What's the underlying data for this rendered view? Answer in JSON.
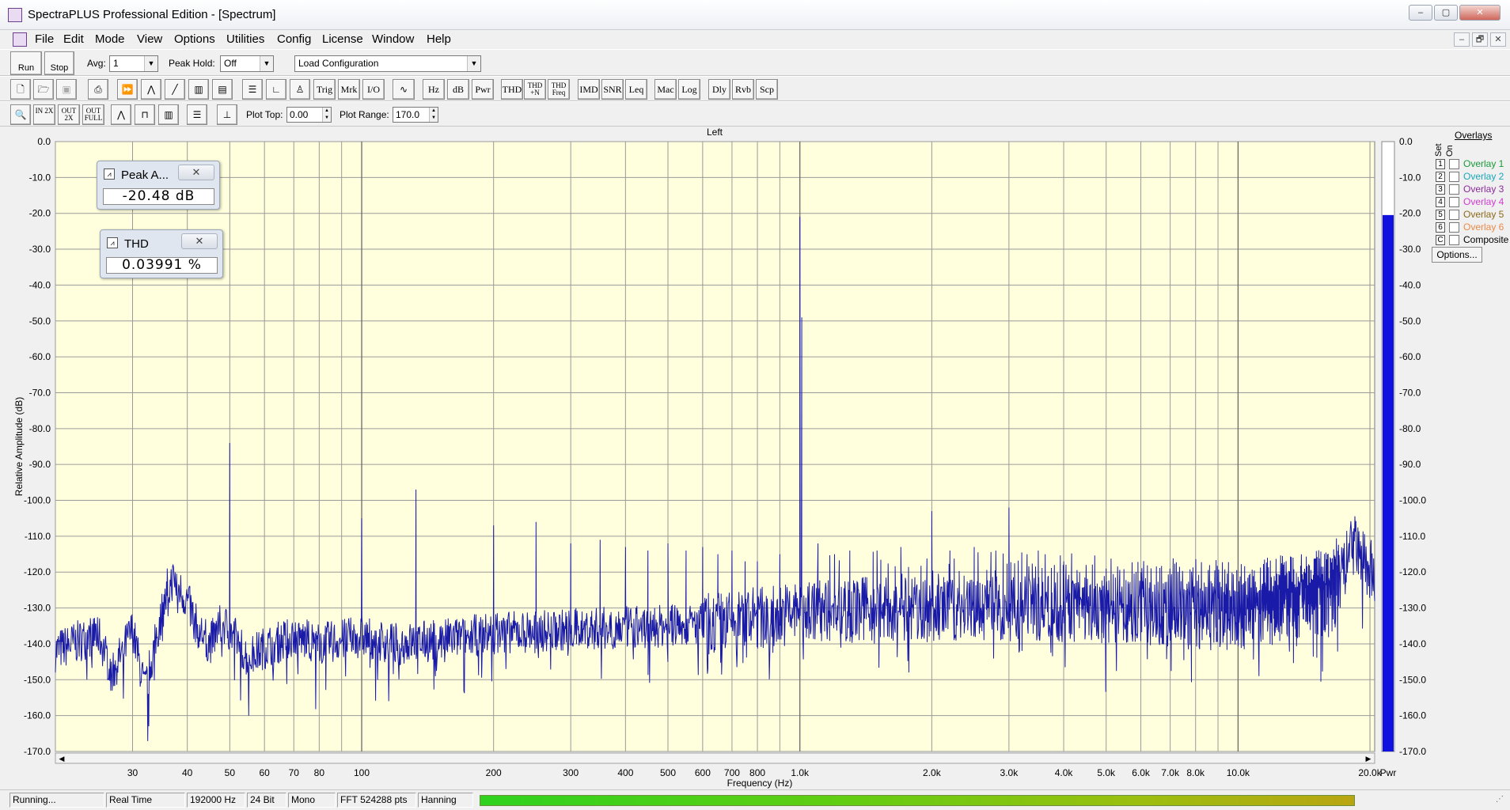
{
  "window": {
    "title": "SpectraPLUS Professional Edition - [Spectrum]",
    "controls": [
      "–",
      "▢",
      "✕"
    ],
    "mdi_controls": [
      "–",
      "🗗",
      "✕"
    ]
  },
  "menu": [
    "File",
    "Edit",
    "Mode",
    "View",
    "Options",
    "Utilities",
    "Config",
    "License",
    "Window",
    "Help"
  ],
  "toolbar1": {
    "run_label": "Run",
    "stop_label": "Stop",
    "avg_label": "Avg:",
    "avg_value": "1",
    "peakhold_label": "Peak Hold:",
    "peakhold_value": "Off",
    "config_value": "Load Configuration"
  },
  "toolbar2": {
    "buttons": [
      "Trig",
      "Mrk",
      "I/O",
      "Hz",
      "dB",
      "Pwr",
      "THD",
      "THD +N",
      "THD Freq",
      "IMD",
      "SNR",
      "Leq",
      "Mac",
      "Log",
      "Dly",
      "Rvb",
      "Scp"
    ]
  },
  "toolbar3": {
    "zoom_buttons": [
      "IN 2X",
      "OUT 2X",
      "OUT FULL"
    ],
    "plot_top_label": "Plot Top:",
    "plot_top_value": "0.00",
    "plot_range_label": "Plot Range:",
    "plot_range_value": "170.0"
  },
  "meters": [
    {
      "title": "Peak A...",
      "value": "-20.48 dB"
    },
    {
      "title": "THD",
      "value": "0.03991 %"
    }
  ],
  "overlays": {
    "title": "Overlays",
    "set_label": "Set",
    "on_label": "On",
    "rows": [
      {
        "num": "1",
        "label": "Overlay 1",
        "color": "#1a9a3a"
      },
      {
        "num": "2",
        "label": "Overlay 2",
        "color": "#1aa6b8"
      },
      {
        "num": "3",
        "label": "Overlay 3",
        "color": "#8a2a9a"
      },
      {
        "num": "4",
        "label": "Overlay 4",
        "color": "#d23ad2"
      },
      {
        "num": "5",
        "label": "Overlay 5",
        "color": "#8a6a1a"
      },
      {
        "num": "6",
        "label": "Overlay 6",
        "color": "#e88a4a"
      },
      {
        "num": "C",
        "label": "Composite",
        "color": "#000000"
      }
    ],
    "options_label": "Options..."
  },
  "status": {
    "cells": [
      "Running...",
      "Real Time",
      "192000 Hz",
      "24 Bit",
      "Mono",
      "FFT 524288 pts",
      "Hanning"
    ]
  },
  "chart_data": {
    "type": "line",
    "title": "Left",
    "xlabel": "Frequency (Hz)",
    "ylabel": "Relative Amplitude (dB)",
    "x_scale": "log",
    "xlim": [
      20,
      20500
    ],
    "ylim": [
      -170,
      0
    ],
    "grid": true,
    "x_ticks": [
      30,
      40,
      50,
      60,
      70,
      80,
      100,
      200,
      300,
      400,
      500,
      600,
      700,
      800,
      1000,
      2000,
      3000,
      4000,
      5000,
      6000,
      7000,
      8000,
      10000,
      20000
    ],
    "x_tick_labels": [
      "30",
      "40",
      "50",
      "60",
      "70",
      "80",
      "100",
      "200",
      "300",
      "400",
      "500",
      "600",
      "700",
      "800",
      "1.0k",
      "2.0k",
      "3.0k",
      "4.0k",
      "5.0k",
      "6.0k",
      "7.0k",
      "8.0k",
      "10.0k",
      "20.0k"
    ],
    "y_ticks": [
      0,
      -10,
      -20,
      -30,
      -40,
      -50,
      -60,
      -70,
      -80,
      -90,
      -100,
      -110,
      -120,
      -130,
      -140,
      -150,
      -160,
      -170
    ],
    "y_tick_labels": [
      "0.0",
      "-10.0",
      "-20.0",
      "-30.0",
      "-40.0",
      "-50.0",
      "-60.0",
      "-70.0",
      "-80.0",
      "-90.0",
      "-100.0",
      "-110.0",
      "-120.0",
      "-130.0",
      "-140.0",
      "-150.0",
      "-160.0",
      "-170.0"
    ],
    "series_color": "#1a1aa8",
    "plot_bg": "#ffffdd",
    "noise_floor": [
      [
        20,
        -142
      ],
      [
        25,
        -137
      ],
      [
        27,
        -148
      ],
      [
        30,
        -136
      ],
      [
        32,
        -153
      ],
      [
        35,
        -131
      ],
      [
        37,
        -122
      ],
      [
        40,
        -128
      ],
      [
        42,
        -135
      ],
      [
        45,
        -140
      ],
      [
        48,
        -134
      ],
      [
        52,
        -139
      ],
      [
        55,
        -144
      ],
      [
        60,
        -141
      ],
      [
        70,
        -138
      ],
      [
        80,
        -140
      ],
      [
        90,
        -139
      ],
      [
        100,
        -138
      ],
      [
        120,
        -140
      ],
      [
        150,
        -139
      ],
      [
        200,
        -137
      ],
      [
        300,
        -136
      ],
      [
        500,
        -135
      ],
      [
        700,
        -134
      ],
      [
        1000,
        -131
      ],
      [
        1500,
        -130
      ],
      [
        2000,
        -131
      ],
      [
        3000,
        -130
      ],
      [
        5000,
        -131
      ],
      [
        8000,
        -132
      ],
      [
        10000,
        -133
      ],
      [
        14000,
        -130
      ],
      [
        16500,
        -129
      ],
      [
        17500,
        -118
      ],
      [
        18500,
        -112
      ],
      [
        19500,
        -118
      ],
      [
        20500,
        -121
      ]
    ],
    "peaks": [
      [
        50,
        -84
      ],
      [
        36,
        -119
      ],
      [
        100,
        -105
      ],
      [
        133,
        -97
      ],
      [
        200,
        -107
      ],
      [
        250,
        -106
      ],
      [
        300,
        -112
      ],
      [
        350,
        -111
      ],
      [
        400,
        -113
      ],
      [
        450,
        -114
      ],
      [
        500,
        -112
      ],
      [
        550,
        -114
      ],
      [
        600,
        -113
      ],
      [
        650,
        -115
      ],
      [
        700,
        -114
      ],
      [
        750,
        -117
      ],
      [
        800,
        -117
      ],
      [
        900,
        -115
      ],
      [
        1000,
        -21
      ],
      [
        1010,
        -49
      ],
      [
        1100,
        -112
      ],
      [
        1200,
        -115
      ],
      [
        1300,
        -114
      ],
      [
        1500,
        -114
      ],
      [
        1700,
        -113
      ],
      [
        2000,
        -103
      ],
      [
        2200,
        -114
      ],
      [
        2500,
        -113
      ],
      [
        2800,
        -114
      ],
      [
        3000,
        -102
      ],
      [
        3300,
        -115
      ],
      [
        3500,
        -114
      ],
      [
        4000,
        -117
      ],
      [
        4500,
        -118
      ],
      [
        5000,
        -119
      ],
      [
        6000,
        -120
      ],
      [
        7000,
        -121
      ]
    ],
    "pwr_bar": {
      "label": "Pwr",
      "level": -20.48
    }
  }
}
